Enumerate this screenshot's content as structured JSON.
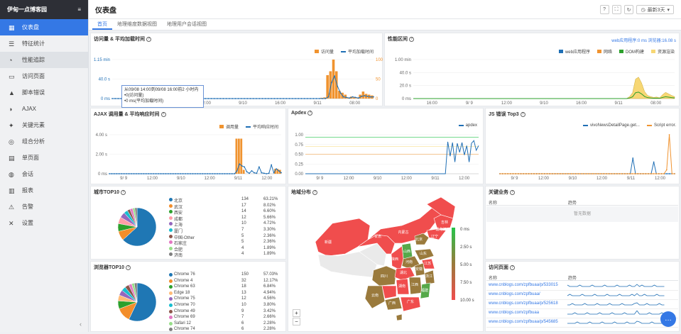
{
  "app": {
    "brand": "伊甸一点博客园"
  },
  "sidebar": {
    "items": [
      {
        "label": "仪表盘",
        "icon": "grid-icon"
      },
      {
        "label": "特征统计",
        "icon": "list-icon"
      },
      {
        "label": "性能追踪",
        "icon": "gauge-icon"
      },
      {
        "label": "访问页面",
        "icon": "page-icon"
      },
      {
        "label": "脚本错误",
        "icon": "warning-icon"
      },
      {
        "label": "AJAX",
        "icon": "contrast-icon"
      },
      {
        "label": "关键元素",
        "icon": "star-icon"
      },
      {
        "label": "组合分析",
        "icon": "target-icon"
      },
      {
        "label": "单页面",
        "icon": "doc-icon"
      },
      {
        "label": "会话",
        "icon": "chat-icon"
      },
      {
        "label": "报表",
        "icon": "report-icon"
      },
      {
        "label": "告警",
        "icon": "alert-icon"
      },
      {
        "label": "设置",
        "icon": "wrench-icon"
      }
    ],
    "collapse": "‹"
  },
  "header": {
    "title": "仪表盘",
    "buttons": {
      "help": "?",
      "fullscreen": "⛶",
      "refresh": "↻",
      "range": "最新3天"
    }
  },
  "tabs": [
    {
      "label": "首页"
    },
    {
      "label": "地理维度数据视图"
    },
    {
      "label": "地理用户会话视图"
    }
  ],
  "panels": {
    "visits": {
      "title": "访问量 & 平均加载时间",
      "legend": [
        "访问量",
        "平均加载时间"
      ],
      "yleft": [
        "1.15 min",
        "40.0 s",
        "0 ms"
      ],
      "yright": [
        "100",
        "50",
        "0"
      ],
      "xticks": [
        "16:00",
        "9/9",
        "12:00",
        "9/10",
        "16:00",
        "9/11",
        "08:00"
      ],
      "tooltip": {
        "line1": "从09/08 14:00到09/08 16:00前2 小时内",
        "line2": "•0(访问量)",
        "line3": "•0 ms(平均加载时间)"
      }
    },
    "perf": {
      "title": "性能区间",
      "subtitle": "web应用程序:0 ms  浏览器:16.08 s",
      "legend": [
        "web应用程序",
        "网络",
        "DOM构建",
        "资源渲染"
      ],
      "yticks": [
        "1.00 min",
        "40.0 s",
        "20.0 s",
        "0 ms"
      ],
      "xticks": [
        "16:00",
        "9/ 9",
        "12:00",
        "9/10",
        "16:00",
        "9/11",
        "08:00"
      ]
    },
    "ajax": {
      "title": "AJAX 调用量 & 平均响应时间",
      "legend": [
        "调用量",
        "平均响应时间"
      ],
      "yleft": [
        "4.00 s",
        "2.00 s",
        "0 ms"
      ],
      "xticks": [
        "9/ 9",
        "12:00",
        "9/10",
        "12:00",
        "9/11",
        "12:00"
      ]
    },
    "apdex": {
      "title": "Apdex",
      "legend": [
        "apdex"
      ],
      "yticks": [
        "1.00",
        "0.75",
        "0.50",
        "0.25",
        "0.00"
      ],
      "xticks": [
        "9/ 9",
        "12:00",
        "9/10",
        "12:00",
        "9/11",
        "12:00"
      ]
    },
    "js": {
      "title": "JS 错误 Top3",
      "legend": [
        "vivoNewsDetailPage.get...",
        "Script error."
      ],
      "xticks": [
        "9/ 9",
        "12:00",
        "9/10",
        "12:00",
        "9/11",
        "12:00"
      ]
    },
    "city": {
      "title": "城市TOP10",
      "rows": [
        {
          "name": "北京",
          "count": "134",
          "pct": "63.21%",
          "color": "#1f77b4"
        },
        {
          "name": "武汉",
          "count": "17",
          "pct": "8.02%",
          "color": "#f28e2b"
        },
        {
          "name": "西安",
          "count": "14",
          "pct": "6.60%",
          "color": "#2ca02c"
        },
        {
          "name": "成都",
          "count": "12",
          "pct": "5.66%",
          "color": "#ff9da7"
        },
        {
          "name": "上海",
          "count": "10",
          "pct": "4.72%",
          "color": "#9467bd"
        },
        {
          "name": "厦门",
          "count": "7",
          "pct": "3.30%",
          "color": "#17becf"
        },
        {
          "name": "中国-Other",
          "count": "5",
          "pct": "2.36%",
          "color": "#8c564b"
        },
        {
          "name": "石家庄",
          "count": "5",
          "pct": "2.36%",
          "color": "#e377c2"
        },
        {
          "name": "合肥",
          "count": "4",
          "pct": "1.89%",
          "color": "#98df8a"
        },
        {
          "name": "济南",
          "count": "4",
          "pct": "1.89%",
          "color": "#7f7f7f"
        }
      ]
    },
    "browser": {
      "title": "浏览器TOP10",
      "rows": [
        {
          "name": "Chrome 76",
          "count": "150",
          "pct": "57.03%",
          "color": "#1f77b4"
        },
        {
          "name": "Chrome 4",
          "count": "32",
          "pct": "12.17%",
          "color": "#f28e2b"
        },
        {
          "name": "Chrome 63",
          "count": "18",
          "pct": "6.84%",
          "color": "#2ca02c"
        },
        {
          "name": "Edge 18",
          "count": "13",
          "pct": "4.94%",
          "color": "#ffbb78"
        },
        {
          "name": "Chrome 75",
          "count": "12",
          "pct": "4.56%",
          "color": "#9467bd"
        },
        {
          "name": "Chrome 70",
          "count": "10",
          "pct": "3.80%",
          "color": "#17becf"
        },
        {
          "name": "Chrome 49",
          "count": "9",
          "pct": "3.42%",
          "color": "#8c564b"
        },
        {
          "name": "Chrome 69",
          "count": "7",
          "pct": "2.66%",
          "color": "#e377c2"
        },
        {
          "name": "Safari 12",
          "count": "6",
          "pct": "2.28%",
          "color": "#98df8a"
        },
        {
          "name": "Chrome 74",
          "count": "6",
          "pct": "2.28%",
          "color": "#7f7f7f"
        }
      ]
    },
    "map": {
      "title": "地域分布",
      "scale": [
        "0 ms",
        "2.50 s",
        "5.00 s",
        "7.50 s",
        "10.00 s"
      ],
      "zoom_in": "+",
      "zoom_out": "−",
      "labels": [
        "黑龙江",
        "吉林",
        "辽宁",
        "新疆",
        "甘肃",
        "内蒙古",
        "北京",
        "山西",
        "陕西",
        "河南",
        "山东",
        "安徽",
        "江苏",
        "四川",
        "湖北",
        "浙江",
        "湖南",
        "江西",
        "福建",
        "广西",
        "广东",
        "云南"
      ]
    },
    "biz": {
      "title": "关键业务",
      "cols": [
        "名称",
        "趋势"
      ],
      "empty": "暂无数据"
    },
    "pages": {
      "title": "访问页面",
      "cols": [
        "名称",
        "趋势"
      ],
      "rows": [
        "www.cnblogs.com/zpfbuaa/p/533015",
        "www.cnblogs.com/zpfbuaa/",
        "www.cnblogs.com/zpfbuaa/p/525618",
        "www.cnblogs.com/zpfbuaa",
        "www.cnblogs.com/zpfbuaa/p/545685"
      ]
    }
  },
  "colors": {
    "accent": "#3478e5",
    "orange": "#f0932f",
    "blue": "#1f6fb5",
    "yellow": "#f7d774",
    "red": "#f04d4d",
    "green": "#25c44a",
    "olive": "#9a7a3c"
  },
  "chart_data": [
    {
      "type": "bar",
      "name": "访问量 & 平均加载时间",
      "x": [
        "16:00",
        "9/9",
        "12:00",
        "9/10",
        "16:00",
        "9/11",
        "08:00"
      ],
      "series": [
        {
          "name": "访问量",
          "values": [
            0,
            0,
            0,
            0,
            0,
            0,
            0,
            0,
            0,
            0,
            0,
            0,
            0,
            0,
            0,
            0,
            0,
            0,
            0,
            0,
            0,
            0,
            0,
            0,
            0,
            0,
            0,
            0,
            0,
            0,
            0,
            0,
            0,
            0,
            0,
            0,
            0,
            0,
            0,
            0,
            0,
            0,
            0,
            0,
            0,
            0,
            0,
            0,
            0,
            0,
            0,
            0,
            0,
            0,
            0,
            0,
            0,
            0,
            0,
            0,
            0,
            0,
            0,
            0,
            0,
            0,
            0,
            0,
            0,
            0,
            2,
            3,
            60,
            70,
            100,
            70,
            20,
            15,
            10,
            2,
            5,
            3,
            1,
            10,
            18,
            12,
            10,
            8
          ]
        },
        {
          "name": "平均加载时间",
          "values": [
            0,
            0,
            0,
            0,
            0,
            0,
            0,
            0,
            0,
            0,
            0,
            0,
            0,
            0,
            0,
            0,
            0,
            0,
            0,
            0,
            0,
            0,
            0,
            0,
            0,
            0,
            0,
            0,
            0,
            0,
            0,
            0,
            0,
            0,
            0,
            0,
            0,
            0,
            0,
            0,
            0,
            0,
            0,
            0,
            0,
            0,
            0,
            0,
            0,
            0,
            0,
            0,
            0,
            0,
            0,
            0,
            0,
            0,
            0,
            0,
            0,
            0,
            0,
            0,
            0,
            0,
            0,
            0,
            0,
            0,
            0,
            0,
            3,
            28,
            40,
            22,
            10,
            3,
            2,
            1,
            3,
            2,
            1,
            4,
            5,
            4,
            3,
            3
          ]
        }
      ]
    },
    {
      "type": "area",
      "name": "性能区间",
      "series": [
        {
          "name": "资源渲染",
          "values": [
            0,
            0,
            0,
            0,
            0,
            0,
            0,
            0,
            0,
            0,
            0,
            0,
            0,
            0,
            0,
            0,
            0,
            0,
            0,
            0,
            0,
            0,
            0,
            0,
            0,
            0,
            0,
            0,
            0,
            0,
            0,
            0,
            0,
            0,
            0,
            0,
            0,
            0,
            0,
            0,
            0,
            0,
            0,
            0,
            0,
            0,
            0,
            0,
            0,
            0,
            0,
            0,
            0,
            0,
            0,
            0,
            0,
            0,
            0,
            0,
            0,
            0,
            0,
            0,
            0,
            0,
            0,
            0,
            0,
            0,
            0,
            0,
            0.05,
            0.15,
            0.5,
            0.55,
            0.4,
            0.18,
            0.08,
            0.05,
            0.03,
            0.04,
            0.02,
            0.1,
            0.16,
            0.12,
            0.08,
            0.05
          ]
        }
      ]
    },
    {
      "type": "bar",
      "name": "AJAX 调用量 & 平均响应时间",
      "series": [
        {
          "name": "调用量",
          "values": [
            0,
            0,
            0,
            0,
            0,
            0,
            0,
            0,
            0,
            0,
            0,
            0,
            0,
            0,
            0,
            0,
            0,
            0,
            0,
            0,
            0,
            0,
            0,
            0,
            0,
            0,
            0,
            0,
            0,
            0,
            0,
            0,
            0,
            0,
            0,
            0,
            0,
            0,
            0,
            0,
            0,
            0,
            0,
            0,
            0,
            0,
            0,
            0,
            0,
            0,
            0,
            0,
            3.6,
            3.6,
            3.6,
            0.4,
            0,
            0,
            0,
            0,
            0,
            0,
            0,
            0,
            0,
            0,
            0,
            0,
            0.5,
            0.5,
            0.4
          ]
        },
        {
          "name": "平均响应时间",
          "values": [
            0,
            0,
            0,
            0,
            0,
            0,
            0,
            0,
            0,
            0,
            0,
            0,
            0,
            0,
            0,
            0,
            0,
            0,
            0,
            0,
            0,
            0,
            0,
            0,
            0,
            0,
            0,
            0,
            0,
            0,
            0,
            0,
            0,
            0,
            0,
            0,
            0,
            0,
            0,
            0,
            0,
            0,
            0,
            0,
            0,
            0,
            0,
            0,
            0,
            0,
            0,
            0,
            0.3,
            1.0,
            0.8,
            0.7,
            0.2,
            0.05,
            0.3,
            0.1,
            0.05,
            0.7,
            0.1,
            0.05,
            0,
            0.05,
            0.9,
            0.1,
            0.5,
            0.3,
            0.1
          ]
        }
      ]
    },
    {
      "type": "line",
      "name": "Apdex",
      "series": [
        {
          "name": "apdex",
          "values": [
            0,
            0,
            0,
            0,
            0,
            0,
            0,
            0,
            0,
            0,
            0,
            0,
            0,
            0,
            0,
            0,
            0,
            0,
            0,
            0,
            0,
            0,
            0,
            0,
            0,
            0,
            0,
            0,
            0,
            0,
            0,
            0,
            0,
            0,
            0,
            0,
            0,
            0,
            0,
            0,
            0,
            0,
            0,
            0,
            0,
            0,
            0,
            0,
            0,
            0,
            0,
            0,
            0,
            0,
            0,
            0,
            0,
            0,
            0,
            0,
            0.82,
            0.45,
            0.8,
            0.3,
            0.78,
            0.55,
            0.8,
            0.48,
            0.72,
            0.3,
            0.78,
            0.85,
            0.6,
            0.72
          ]
        }
      ]
    },
    {
      "type": "line",
      "name": "JS 错误 Top3",
      "series": [
        {
          "name": "vivoNewsDetailPage.get...",
          "values": [
            0,
            0,
            0,
            0,
            0,
            0,
            0,
            0,
            0,
            0,
            0,
            0,
            0,
            0,
            0,
            0,
            0,
            0,
            0,
            0,
            0,
            0,
            0,
            0,
            0,
            0,
            0,
            0,
            0,
            0,
            0,
            0,
            0,
            0,
            0,
            0,
            0,
            0,
            0,
            0,
            0,
            0,
            0,
            0,
            0,
            0,
            0,
            0,
            0,
            0,
            0,
            0.4,
            0,
            0,
            0,
            0,
            0,
            0,
            0,
            0.3,
            0,
            0,
            0,
            0,
            0,
            0,
            0,
            0
          ]
        },
        {
          "name": "Script error.",
          "values": [
            0,
            0,
            0,
            0,
            0,
            0,
            0,
            0,
            0,
            0,
            0,
            0,
            0,
            0,
            0,
            0,
            0,
            0,
            0,
            0,
            0,
            0,
            0,
            0,
            0,
            0,
            0,
            0,
            0,
            0,
            0,
            0,
            0,
            0,
            0,
            0,
            0,
            0,
            0,
            0,
            0,
            0,
            0,
            0,
            0,
            0,
            0,
            0,
            0,
            0,
            0,
            0,
            0,
            0,
            0,
            0,
            0,
            0,
            0,
            0,
            0,
            0,
            0,
            0.1,
            1.0,
            0,
            0
          ]
        }
      ]
    },
    {
      "type": "pie",
      "name": "城市TOP10",
      "values": [
        134,
        17,
        14,
        12,
        10,
        7,
        5,
        5,
        4,
        4
      ]
    },
    {
      "type": "pie",
      "name": "浏览器TOP10",
      "values": [
        150,
        32,
        18,
        13,
        12,
        10,
        9,
        7,
        6,
        6
      ]
    }
  ]
}
